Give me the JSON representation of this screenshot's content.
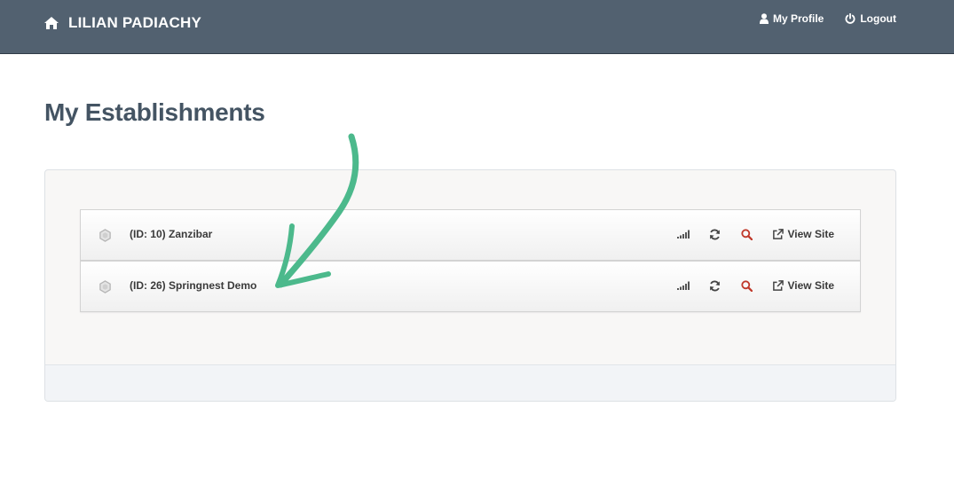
{
  "navbar": {
    "brand": "LILIAN PADIACHY",
    "brand_icon": "home-icon",
    "links": [
      {
        "label": "My Profile",
        "icon": "user-icon"
      },
      {
        "label": "Logout",
        "icon": "power-icon"
      }
    ]
  },
  "page": {
    "title": "My Establishments"
  },
  "establishments": [
    {
      "name": "(ID: 10) Zanzibar",
      "view_label": "View Site"
    },
    {
      "name": "(ID: 26) Springnest Demo",
      "view_label": "View Site"
    }
  ],
  "colors": {
    "navbar": "#526170",
    "title": "#445463",
    "search_icon": "#c0392b",
    "annotation_arrow": "#4cb98c"
  }
}
